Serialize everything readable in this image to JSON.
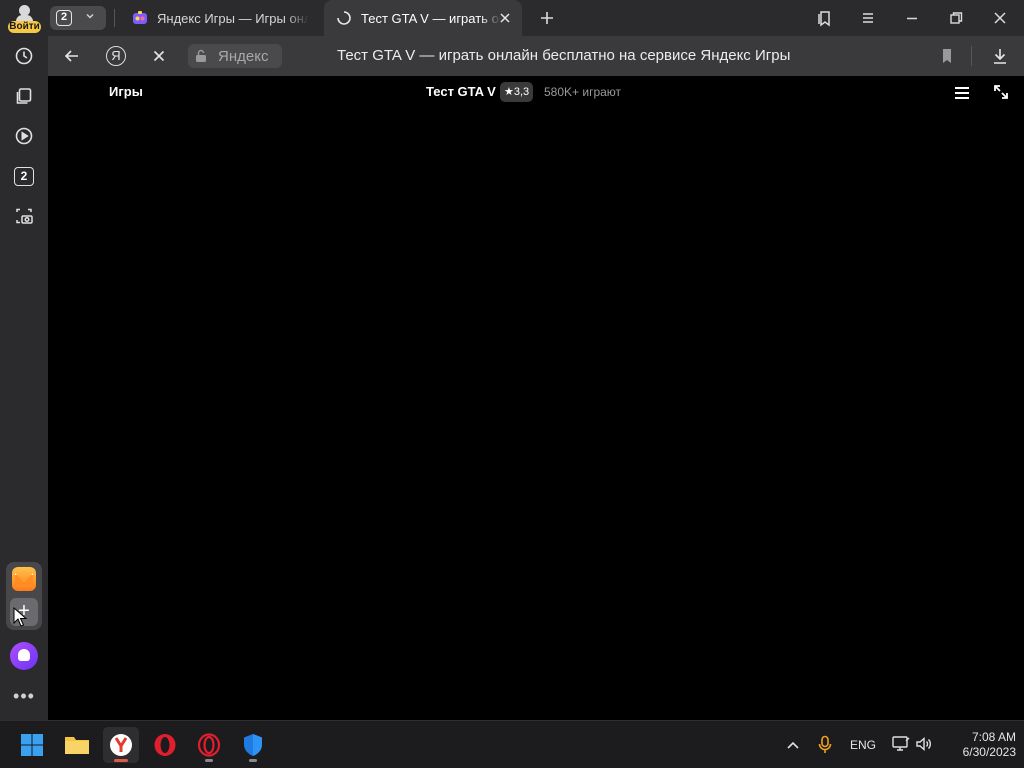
{
  "sidebar": {
    "login_label": "Войти",
    "tab_count": "2"
  },
  "tabs": {
    "count": "2",
    "items": [
      {
        "title": "Яндекс Игры — Игры онлайн",
        "favicon": "yandex-games-icon"
      },
      {
        "title": "Тест GTA V — играть онлайн",
        "favicon": "loading-spinner-icon",
        "active": true
      }
    ]
  },
  "address_bar": {
    "site_label": "Яндекс",
    "page_title": "Тест GTA V — играть онлайн бесплатно на сервисе Яндекс Игры"
  },
  "game_header": {
    "games_link": "Игры",
    "game_title": "Тест GTA V",
    "rating": "★3,3",
    "players": "580K+ играют"
  },
  "taskbar": {
    "language": "ENG",
    "time": "7:08 AM",
    "date": "6/30/2023"
  },
  "colors": {
    "accent_yellow": "#f7c843",
    "chrome_dark": "#2b2b2d",
    "content_bg": "#000000"
  }
}
